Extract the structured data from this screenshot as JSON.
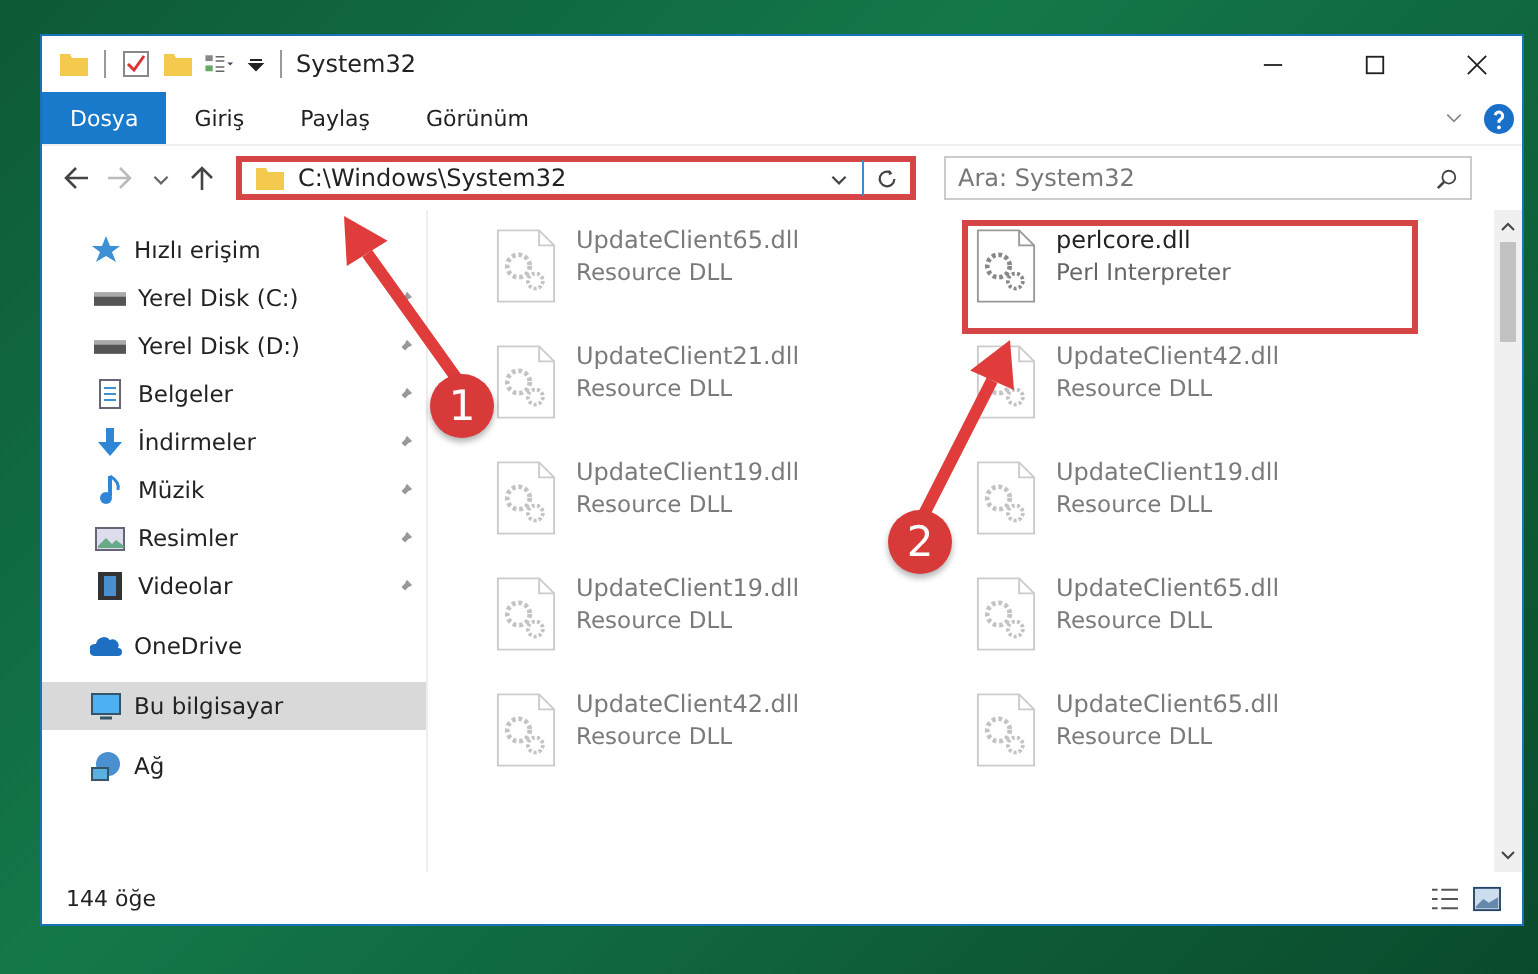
{
  "window": {
    "title": "System32"
  },
  "ribbon_tabs": [
    {
      "label": "Dosya",
      "selected": true
    },
    {
      "label": "Giriş",
      "selected": false
    },
    {
      "label": "Paylaş",
      "selected": false
    },
    {
      "label": "Görünüm",
      "selected": false
    }
  ],
  "address_bar": {
    "path": "C:\\Windows\\System32",
    "highlighted": true
  },
  "search": {
    "placeholder": "Ara: System32"
  },
  "sidebar": {
    "items": [
      {
        "label": "Hızlı erişim",
        "kind": "star",
        "selected": false,
        "children": [
          {
            "label": "Yerel Disk (C:)",
            "kind": "drive",
            "pinned": true,
            "selected": false
          },
          {
            "label": "Yerel Disk (D:)",
            "kind": "drive",
            "pinned": true,
            "selected": false
          },
          {
            "label": "Belgeler",
            "kind": "document",
            "pinned": true,
            "selected": false
          },
          {
            "label": "İndirmeler",
            "kind": "download",
            "pinned": true,
            "selected": false
          },
          {
            "label": "Müzik",
            "kind": "music",
            "pinned": true,
            "selected": false
          },
          {
            "label": "Resimler",
            "kind": "pictures",
            "pinned": true,
            "selected": false
          },
          {
            "label": "Videolar",
            "kind": "video",
            "pinned": true,
            "selected": false
          }
        ]
      },
      {
        "label": "OneDrive",
        "kind": "cloud",
        "selected": false
      },
      {
        "label": "Bu bilgisayar",
        "kind": "computer",
        "selected": true
      },
      {
        "label": "Ağ",
        "kind": "network",
        "selected": false
      }
    ]
  },
  "files": [
    {
      "name": "UpdateClient65.dll",
      "type": "Resource DLL",
      "blurred": true,
      "highlighted": false
    },
    {
      "name": "perlcore.dll",
      "type": "Perl Interpreter",
      "blurred": false,
      "highlighted": true
    },
    {
      "name": "UpdateClient21.dll",
      "type": "Resource DLL",
      "blurred": true,
      "highlighted": false
    },
    {
      "name": "UpdateClient42.dll",
      "type": "Resource DLL",
      "blurred": true,
      "highlighted": false
    },
    {
      "name": "UpdateClient19.dll",
      "type": "Resource DLL",
      "blurred": true,
      "highlighted": false
    },
    {
      "name": "UpdateClient19.dll",
      "type": "Resource DLL",
      "blurred": true,
      "highlighted": false
    },
    {
      "name": "UpdateClient19.dll",
      "type": "Resource DLL",
      "blurred": true,
      "highlighted": false
    },
    {
      "name": "UpdateClient65.dll",
      "type": "Resource DLL",
      "blurred": true,
      "highlighted": false
    },
    {
      "name": "UpdateClient42.dll",
      "type": "Resource DLL",
      "blurred": true,
      "highlighted": false
    },
    {
      "name": "UpdateClient65.dll",
      "type": "Resource DLL",
      "blurred": true,
      "highlighted": false
    }
  ],
  "annotations": [
    {
      "label": "1"
    },
    {
      "label": "2"
    }
  ],
  "status_bar": {
    "count": "144 öğe"
  }
}
